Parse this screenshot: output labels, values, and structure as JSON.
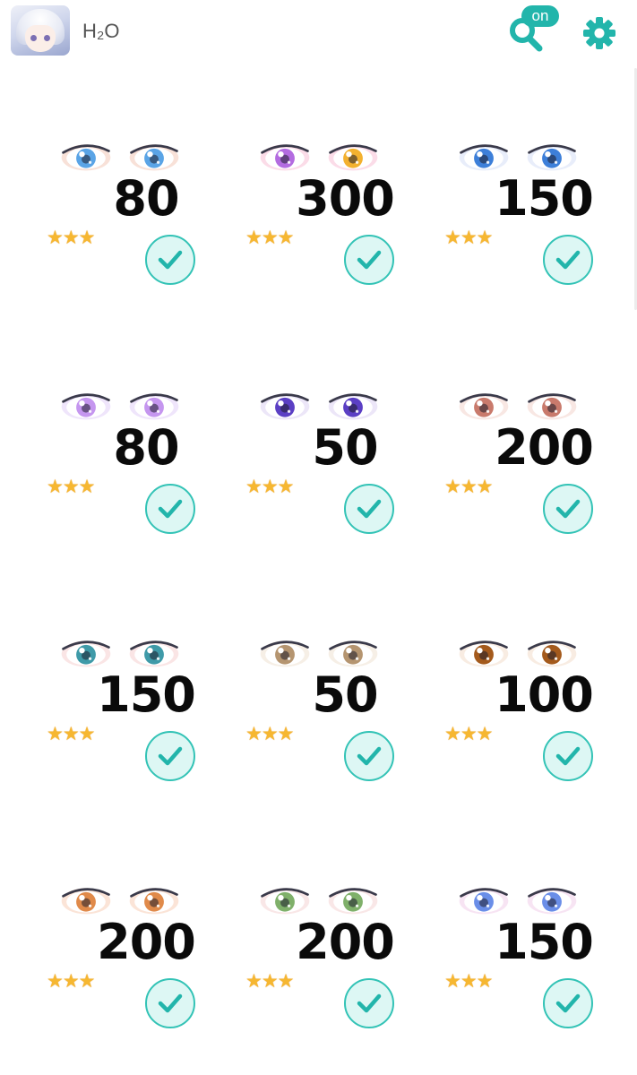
{
  "header": {
    "user_name": "H₂O",
    "search_badge": "on",
    "icons": [
      "avatar",
      "search-icon",
      "settings-gear-icon"
    ],
    "accent_color": "#22b5ab"
  },
  "items": [
    {
      "price": "80",
      "stars": "★★★",
      "iris": "#5aa4e6",
      "rim": "#f3c9b8"
    },
    {
      "price": "300",
      "stars": "★★★",
      "iris": "#b36be0",
      "iris2": "#f3b12f",
      "rim": "#f7c0d6"
    },
    {
      "price": "150",
      "stars": "★★★",
      "iris": "#3d7fd9",
      "rim": "#d6dff6"
    },
    {
      "price": "80",
      "stars": "★★★",
      "iris": "#c596ef",
      "rim": "#e2cff7"
    },
    {
      "price": "50",
      "stars": "★★★",
      "iris": "#5b3fc4",
      "rim": "#dcd2f3"
    },
    {
      "price": "200",
      "stars": "★★★",
      "iris": "#c97a6c",
      "rim": "#f2d3cc"
    },
    {
      "price": "150",
      "stars": "★★★",
      "iris": "#3f9aa8",
      "rim": "#f5d0d0"
    },
    {
      "price": "50",
      "stars": "★★★",
      "iris": "#b59570",
      "rim": "#efe2d2"
    },
    {
      "price": "100",
      "stars": "★★★",
      "iris": "#a45a1c",
      "rim": "#f3dccb"
    },
    {
      "price": "200",
      "stars": "★★★",
      "iris": "#e08a4a",
      "rim": "#f8cdb6"
    },
    {
      "price": "200",
      "stars": "★★★",
      "iris": "#7fb06a",
      "rim": "#f4d3d3"
    },
    {
      "price": "150",
      "stars": "★★★",
      "iris": "#6a8ee8",
      "rim": "#f1cdea"
    }
  ]
}
